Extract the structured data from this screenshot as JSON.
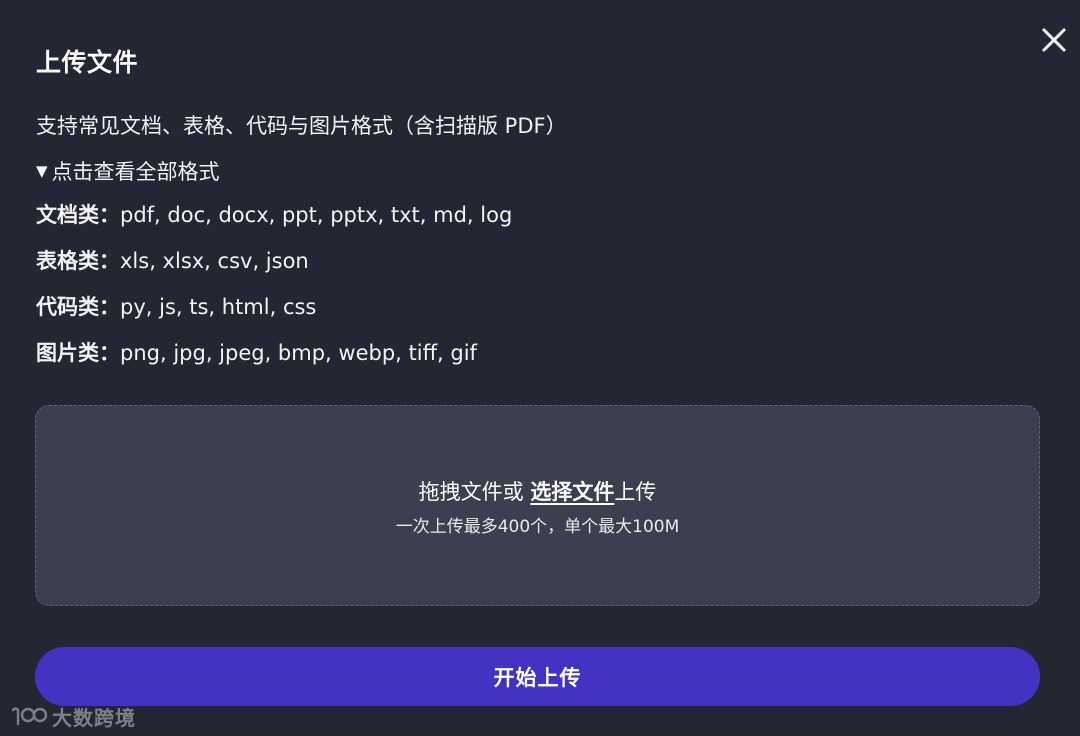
{
  "dialog": {
    "title": "上传文件",
    "close_icon": "close-icon"
  },
  "supports_text": "支持常见文档、表格、代码与图片格式（含扫描版 PDF）",
  "formats_toggle": {
    "indicator": "▼",
    "label": "点击查看全部格式",
    "expanded": true
  },
  "formats": [
    {
      "category": "文档类：",
      "list": "pdf, doc, docx, ppt, pptx, txt, md, log"
    },
    {
      "category": "表格类：",
      "list": "xls, xlsx, csv, json"
    },
    {
      "category": "代码类：",
      "list": "py, js, ts, html, css"
    },
    {
      "category": "图片类：",
      "list": "png, jpg, jpeg, bmp, webp, tiff, gif"
    }
  ],
  "dropzone": {
    "text_before": "拖拽文件或 ",
    "choose_link": "选择文件",
    "text_after": "上传",
    "limit_text": "一次上传最多400个，单个最大100M"
  },
  "start_button": {
    "label": "开始上传"
  },
  "watermark": {
    "text": "大数跨境"
  },
  "colors": {
    "background": "#232733",
    "dropzone": "#3b3f4e",
    "primary_button": "#4234c2",
    "text": "#ffffff"
  }
}
